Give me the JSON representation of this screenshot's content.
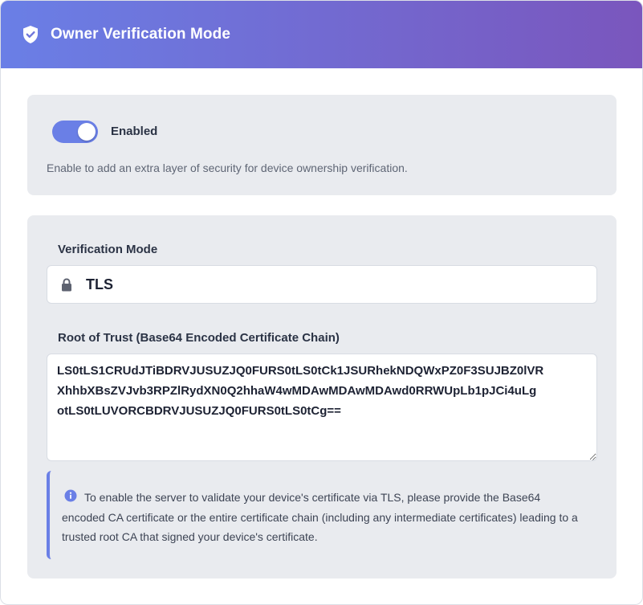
{
  "header": {
    "title": "Owner Verification Mode",
    "icon": "shield-check-icon",
    "gradient": [
      "#6a7fe6",
      "#7a56bd"
    ]
  },
  "toggle": {
    "state": "on",
    "label": "Enabled",
    "description": "Enable to add an extra layer of security for device ownership verification.",
    "color": "#6a7fe6"
  },
  "verification_mode": {
    "label": "Verification Mode",
    "value": "TLS",
    "icon": "lock-icon"
  },
  "root_of_trust": {
    "label": "Root of Trust (Base64 Encoded Certificate Chain)",
    "lines": [
      "LS0tLS1CRUdJTiBDRVJUSUZJQ0FURS0tLS0tCk1JSURhekNDQWxPZ0F3SUJBZ0lVR",
      "XhhbXBsZVJvb3RPZlRydXN0Q2hhaW4wMDAwMDAwMDAwd0RRWUpLb1pJCi4uLg",
      "otLS0tLUVORCBDRVJUSUZJQ0FURS0tLS0tCg=="
    ]
  },
  "info": {
    "icon": "info-icon",
    "text": "To enable the server to validate your device's certificate via TLS, please provide the Base64 encoded CA certificate or the entire certificate chain (including any intermediate certificates) leading to a trusted root CA that signed your device's certificate."
  }
}
